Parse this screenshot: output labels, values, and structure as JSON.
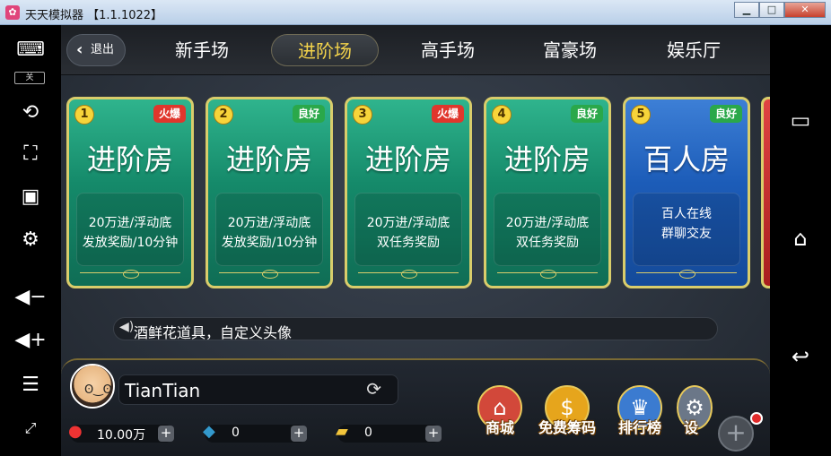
{
  "window": {
    "title": "天天模拟器 【1.1.1022】",
    "minimize": "▁",
    "maximize": "□",
    "close": "✕"
  },
  "emulator_toolbar": {
    "keyboard_toggle": "关",
    "tools": [
      "keyboard-icon",
      "rotate-icon",
      "screenshot-icon",
      "image-icon",
      "settings-icon",
      "volume-down-icon",
      "volume-up-icon",
      "menu-icon",
      "fullscreen-icon"
    ]
  },
  "nav": {
    "back_label": "退出",
    "tabs": [
      {
        "label": "新手场",
        "active": false
      },
      {
        "label": "进阶场",
        "active": true
      },
      {
        "label": "高手场",
        "active": false
      },
      {
        "label": "富豪场",
        "active": false
      },
      {
        "label": "娱乐厅",
        "active": false
      }
    ]
  },
  "rooms": [
    {
      "num": "1",
      "badge": "火爆",
      "badge_color": "#e0362c",
      "title": "进阶房",
      "line1": "20万进/浮动底",
      "line2": "发放奖励/10分钟",
      "theme": "green"
    },
    {
      "num": "2",
      "badge": "良好",
      "badge_color": "#2aa84a",
      "title": "进阶房",
      "line1": "20万进/浮动底",
      "line2": "发放奖励/10分钟",
      "theme": "green"
    },
    {
      "num": "3",
      "badge": "火爆",
      "badge_color": "#e0362c",
      "title": "进阶房",
      "line1": "20万进/浮动底",
      "line2": "双任务奖励",
      "theme": "green"
    },
    {
      "num": "4",
      "badge": "良好",
      "badge_color": "#2aa84a",
      "title": "进阶房",
      "line1": "20万进/浮动底",
      "line2": "双任务奖励",
      "theme": "green"
    },
    {
      "num": "5",
      "badge": "良好",
      "badge_color": "#2aa84a",
      "title": "百人房",
      "line1": "百人在线",
      "line2": "群聊交友",
      "theme": "blue"
    }
  ],
  "marquee": {
    "text": "酒鲜花道具，自定义头像"
  },
  "player": {
    "name": "TianTian",
    "coins": "10.00万",
    "diamonds": "0",
    "ingots": "0"
  },
  "bottom_buttons": [
    {
      "label": "商城",
      "icon": "shop-icon",
      "color": "#d2483a"
    },
    {
      "label": "免费筹码",
      "icon": "coin-icon",
      "color": "#e6a51c"
    },
    {
      "label": "排行榜",
      "icon": "ranking-icon",
      "color": "#3b7bd0"
    },
    {
      "label": "设",
      "icon": "settings-icon",
      "color": "#6b7788"
    }
  ],
  "android_nav": [
    "recent-apps-icon",
    "home-icon",
    "back-icon"
  ]
}
